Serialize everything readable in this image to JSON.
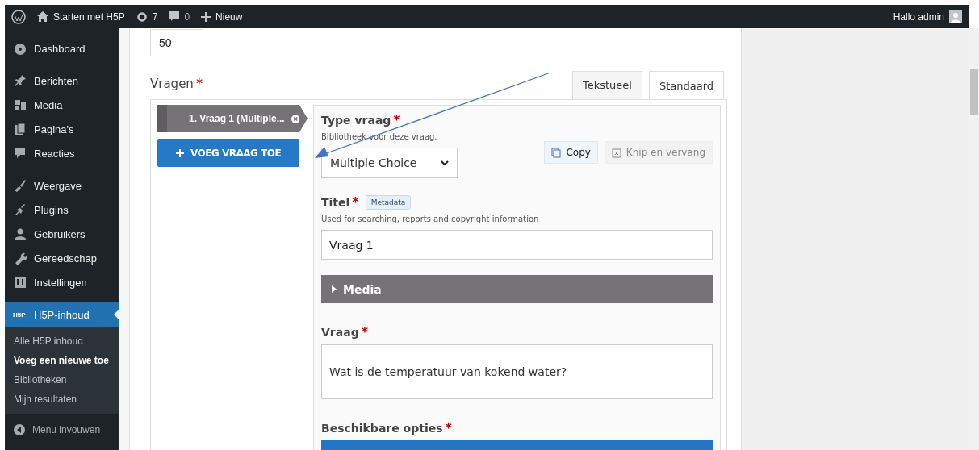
{
  "admin_bar": {
    "site": "Starten met H5P",
    "updates": "7",
    "comments": "0",
    "new": "Nieuw",
    "greeting": "Hallo admin"
  },
  "sidebar": {
    "groups": [
      [
        {
          "label": "Dashboard",
          "selected": false
        }
      ],
      [
        {
          "label": "Berichten",
          "selected": false
        },
        {
          "label": "Media",
          "selected": false
        },
        {
          "label": "Pagina's",
          "selected": false
        },
        {
          "label": "Reacties",
          "selected": false
        }
      ],
      [
        {
          "label": "Weergave",
          "selected": false
        },
        {
          "label": "Plugins",
          "selected": false
        },
        {
          "label": "Gebruikers",
          "selected": false
        },
        {
          "label": "Gereedschap",
          "selected": false
        },
        {
          "label": "Instellingen",
          "selected": false
        }
      ],
      [
        {
          "label": "H5P-inhoud",
          "logo": "H5P",
          "selected": true,
          "submenu": [
            {
              "label": "Alle H5P inhoud",
              "selected": false
            },
            {
              "label": "Voeg een nieuwe toe",
              "selected": true
            },
            {
              "label": "Bibliotheken",
              "selected": false
            },
            {
              "label": "Mijn resultaten",
              "selected": false
            }
          ]
        }
      ]
    ],
    "collapse": "Menu invouwen"
  },
  "editor": {
    "number_value": "50",
    "questions_label": "Vragen",
    "questions_required": "*",
    "tabs": [
      {
        "label": "Tekstueel",
        "selected": false
      },
      {
        "label": "Standaard",
        "selected": true
      }
    ],
    "question_list": [
      {
        "label": "1. Vraag 1 (Multiple...",
        "selected": true
      }
    ],
    "add_button": "VOEG VRAAG TOE",
    "type_label": "Type vraag",
    "type_required": "*",
    "type_description": "Bibliotheek voor deze vraag.",
    "type_value": "Multiple Choice",
    "copy_button": "Copy",
    "paste_button": {
      "label": "Knip en vervang",
      "disabled": true
    },
    "title_label": "Titel",
    "title_required": "*",
    "metadata_button": "Metadata",
    "title_description": "Used for searching, reports and copyright information",
    "title_value": "Vraag 1",
    "media": {
      "label": "Media",
      "expanded": false
    },
    "question_label": "Vraag",
    "question_required": "*",
    "question_value": "Wat is de temperatuur van kokend water?",
    "options_label": "Beschikbare opties",
    "options_required": "*"
  }
}
